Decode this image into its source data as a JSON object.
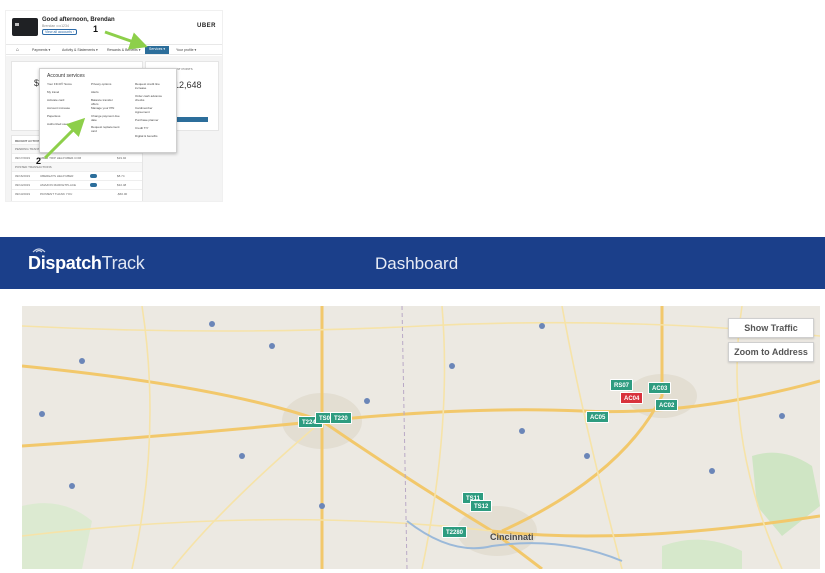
{
  "uber": {
    "greeting": "Good afternoon, Brendan",
    "greeting_sub": "Brendan ••••1234",
    "view_account": "View all accounts ›",
    "brand": "UBER",
    "nav": {
      "home_icon": "home-icon",
      "items": [
        "Payments ▾",
        "Activity & Statements ▾",
        "Rewards & Benefits ▾",
        "Services ▾",
        "Your profile ▾"
      ]
    },
    "balance_prefix": "$",
    "points": "12,648",
    "points_label": "CURRENT POINTS",
    "menu": {
      "title": "Account services",
      "columns": [
        [
          "Your FICO® Score",
          "My travel",
          "Activate card",
          "Account increase",
          "Paperless",
          "Authorized users"
        ],
        [
          "Privacy options",
          "Alerts",
          "Balance transfer offers",
          "Manage your PIN",
          "Change payment due date",
          "Request replacement card"
        ],
        [
          "Request credit line increase",
          "Order cash advance checks",
          "Cardmember Agreement",
          "Purchase planner",
          "Credit TIY",
          "Digital & benefits"
        ]
      ]
    },
    "recent_activity_label": "RECENT ACTIVITY",
    "pending_label": "PENDING TRANSACTIONS",
    "posted_label": "POSTED TRANSACTIONS",
    "rows": [
      {
        "date": "09/17/2019",
        "desc": "UBER TRIP HELP.UBER.COM",
        "amount": "$19.92"
      },
      {
        "date": "09/16/2019",
        "desc": "UBEREATS HELP.UBER",
        "amount": "$8.74"
      },
      {
        "date": "09/14/2019",
        "desc": "AMAZON MARKETPLACE",
        "amount": "$32.48"
      },
      {
        "date": "09/13/2019",
        "desc": "PAYMENT THANK YOU",
        "amount": "-$60.00"
      }
    ],
    "annotations": [
      "1",
      "2"
    ]
  },
  "dispatch": {
    "logo_primary": "Dispatch",
    "logo_secondary": "Track",
    "title": "Dashboard",
    "map_buttons": [
      "Show Traffic",
      "Zoom to Address"
    ],
    "markers": [
      {
        "label": "T2240",
        "color": "green"
      },
      {
        "label": "TS01",
        "color": "green"
      },
      {
        "label": "T220",
        "color": "green"
      },
      {
        "label": "AC05",
        "color": "green"
      },
      {
        "label": "RS07",
        "color": "green"
      },
      {
        "label": "AC04",
        "color": "red"
      },
      {
        "label": "AC03",
        "color": "green"
      },
      {
        "label": "AC02",
        "color": "green"
      },
      {
        "label": "TS11",
        "color": "green"
      },
      {
        "label": "TS12",
        "color": "green"
      },
      {
        "label": "T2280",
        "color": "green"
      }
    ],
    "city_label": "Cincinnati"
  },
  "colors": {
    "dispatch_header": "#1b3f8a",
    "uber_accent": "#2c6e9b",
    "marker_green": "#2e9c80",
    "marker_red": "#d8323c",
    "annotation_arrow": "#8dcf4a"
  }
}
